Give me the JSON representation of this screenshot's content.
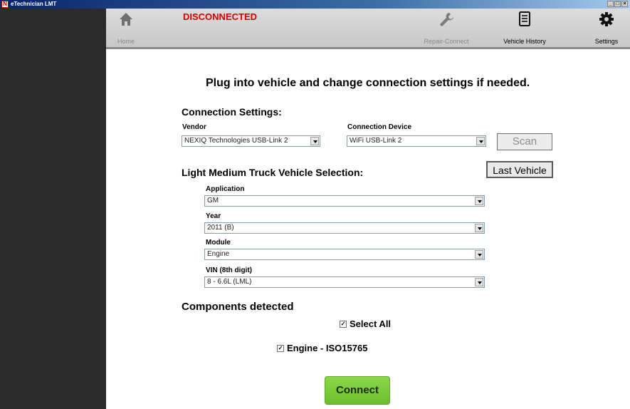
{
  "window": {
    "title": "eTechnician LMT",
    "app_icon": "N",
    "controls": [
      "_",
      "□",
      "×"
    ]
  },
  "toolbar": {
    "status": "DISCONNECTED",
    "status_color": "#d40000",
    "home_label": "Home",
    "repair_connect_label": "Repair-Connect",
    "vehicle_history_label": "Vehicle History",
    "settings_label": "Settings"
  },
  "main": {
    "instruction": "Plug into vehicle and change connection settings if needed.",
    "connection_settings": {
      "title": "Connection Settings:",
      "vendor_label": "Vendor",
      "vendor_value": "NEXIQ Technologies USB-Link 2",
      "device_label": "Connection Device",
      "device_value": "WiFi USB-Link 2",
      "scan_label": "Scan"
    },
    "vehicle_selection": {
      "title": "Light Medium Truck Vehicle Selection:",
      "last_vehicle_label": "Last Vehicle",
      "application_label": "Application",
      "application_value": "GM",
      "year_label": "Year",
      "year_value": "2011 (B)",
      "module_label": "Module",
      "module_value": "Engine",
      "vin_label": "VIN (8th digit)",
      "vin_value": "8 - 6.6L (LML)"
    },
    "components": {
      "title": "Components detected",
      "select_all_label": "Select All",
      "select_all_checked": true,
      "items": [
        {
          "label": "Engine - ISO15765",
          "checked": true
        }
      ]
    },
    "connect_label": "Connect"
  },
  "colors": {
    "accent_green": "#78c83a",
    "sidebar": "#2b2b2b",
    "toolbar": "#d2d2d2"
  }
}
